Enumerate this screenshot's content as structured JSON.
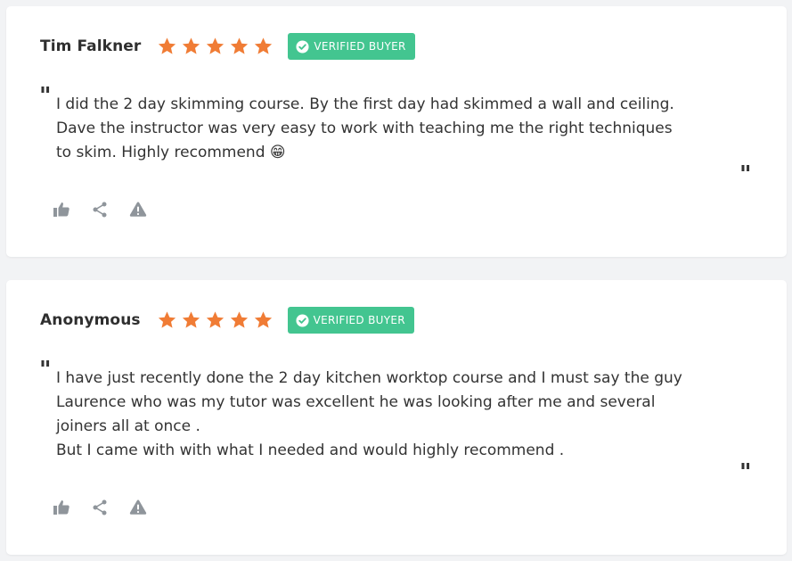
{
  "colors": {
    "star": "#f07c35",
    "badge": "#43c590",
    "icon": "#8f959b"
  },
  "reviews": [
    {
      "name": "Tim Falkner",
      "rating": 5,
      "badge": "VERIFIED BUYER",
      "lines": [
        "I did the 2 day skimming course. By the first day had skimmed a wall and ceiling.",
        "Dave the instructor was very easy to work with teaching me the right techniques",
        "to skim. Highly recommend 😁"
      ],
      "icons": [
        "thumbs-up-icon",
        "share-icon",
        "warning-icon"
      ]
    },
    {
      "name": "Anonymous",
      "rating": 5,
      "badge": "VERIFIED BUYER",
      "lines": [
        "I have just recently done the 2 day kitchen worktop course and I must say the guy",
        "Laurence who was my tutor was excellent he was looking after me and several",
        "joiners all at once .",
        "But I came with with what I needed and would highly recommend ."
      ],
      "icons": [
        "thumbs-up-icon",
        "share-icon",
        "warning-icon"
      ]
    }
  ]
}
